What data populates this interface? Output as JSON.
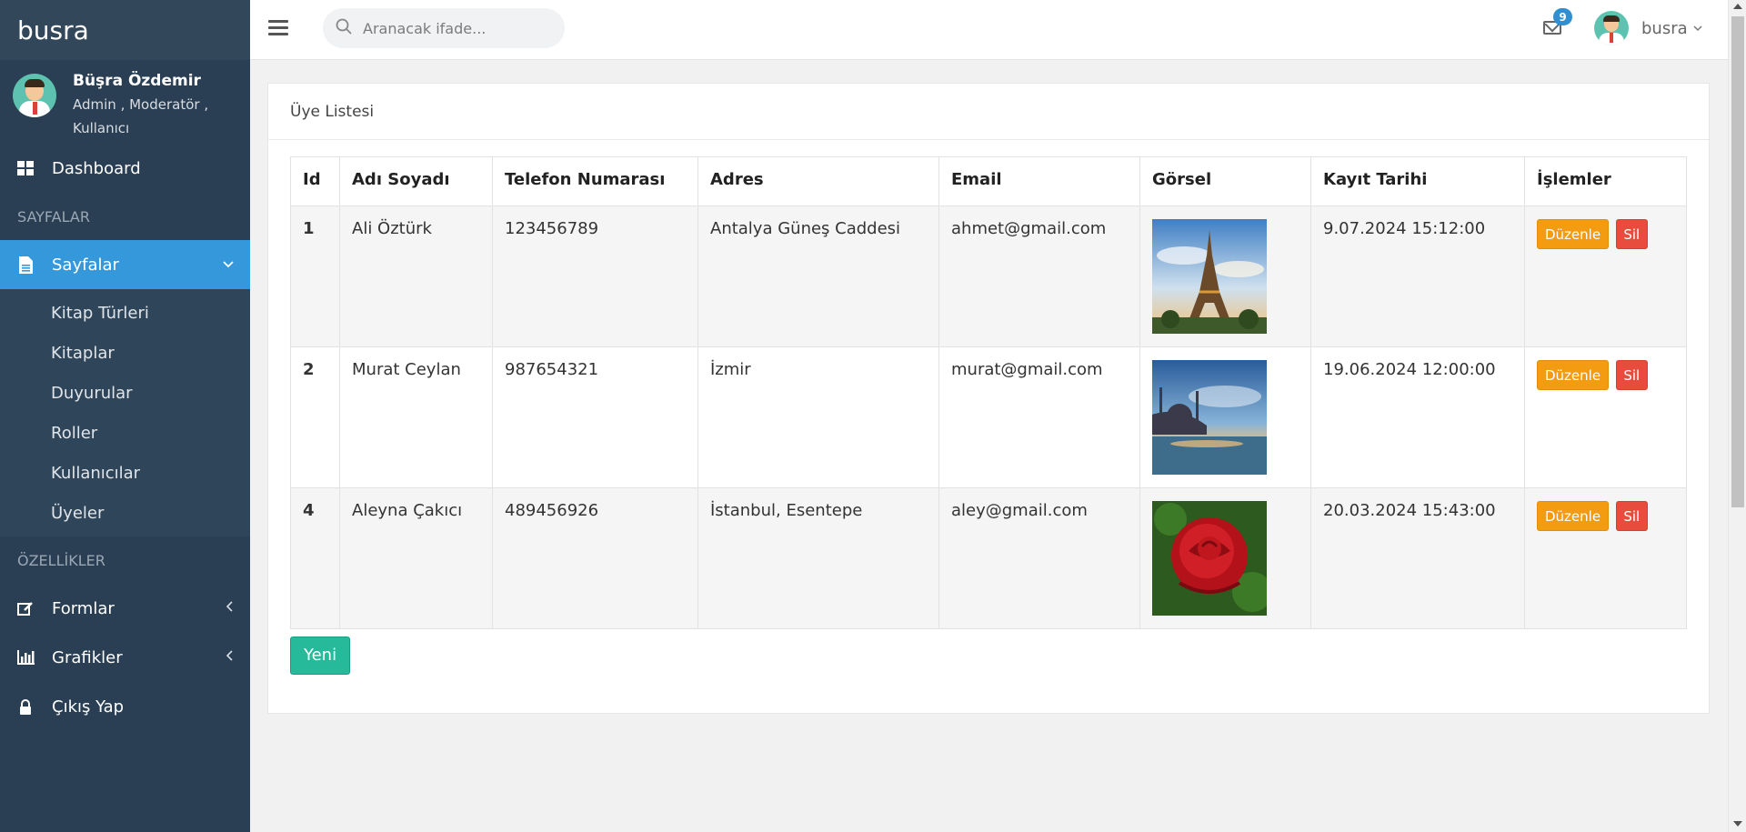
{
  "sidebar": {
    "brand": "busra",
    "profile": {
      "name": "Büşra Özdemir",
      "roles": "Admin , Moderatör , Kullanıcı"
    },
    "dashboard": "Dashboard",
    "section_pages": "SAYFALAR",
    "pages_menu": "Sayfalar",
    "pages_submenu": [
      "Kitap Türleri",
      "Kitaplar",
      "Duyurular",
      "Roller",
      "Kullanıcılar",
      "Üyeler"
    ],
    "section_features": "ÖZELLİKLER",
    "forms": "Formlar",
    "charts": "Grafikler",
    "logout": "Çıkış Yap"
  },
  "topbar": {
    "search_placeholder": "Aranacak ifade...",
    "mail_count": "9",
    "username": "busra"
  },
  "card": {
    "title": "Üye Listesi",
    "columns": [
      "Id",
      "Adı Soyadı",
      "Telefon Numarası",
      "Adres",
      "Email",
      "Görsel",
      "Kayıt Tarihi",
      "İşlemler"
    ],
    "rows": [
      {
        "id": "1",
        "name": "Ali Öztürk",
        "phone": "123456789",
        "address": "Antalya Güneş Caddesi",
        "email": "ahmet@gmail.com",
        "image": "eiffel-tower",
        "date": "9.07.2024 15:12:00"
      },
      {
        "id": "2",
        "name": "Murat Ceylan",
        "phone": "987654321",
        "address": "İzmir",
        "email": "murat@gmail.com",
        "image": "mosque-sunset",
        "date": "19.06.2024 12:00:00"
      },
      {
        "id": "4",
        "name": "Aleyna Çakıcı",
        "phone": "489456926",
        "address": "İstanbul, Esentepe",
        "email": "aley@gmail.com",
        "image": "red-rose",
        "date": "20.03.2024 15:43:00"
      }
    ],
    "edit_label": "Düzenle",
    "delete_label": "Sil",
    "new_label": "Yeni"
  },
  "colors": {
    "sidebar_bg": "#2a3f54",
    "active": "#3498db",
    "edit": "#f39c12",
    "delete": "#e74c3c",
    "new": "#26b99a"
  }
}
